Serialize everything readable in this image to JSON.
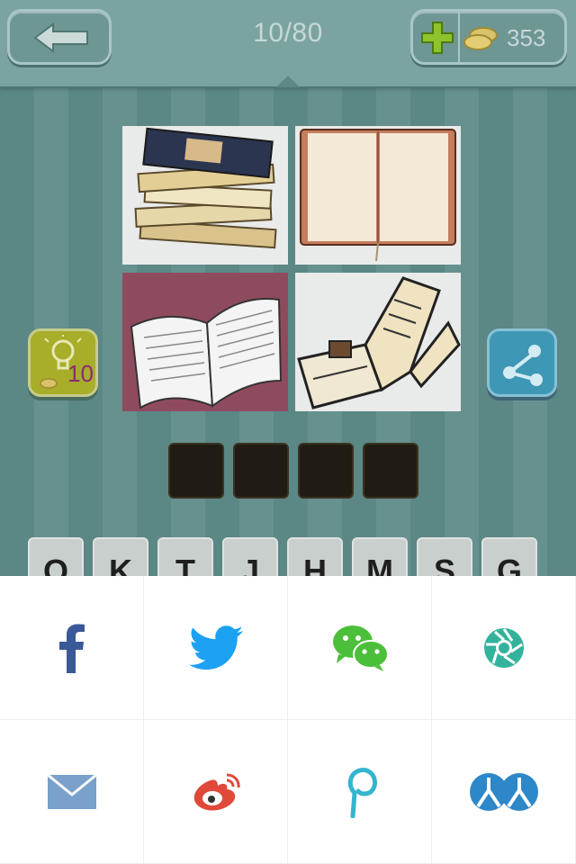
{
  "header": {
    "level": "10/80",
    "coins": "353"
  },
  "hint": {
    "cost": "10"
  },
  "answer_slots": [
    "",
    "",
    "",
    ""
  ],
  "letter_keys": [
    "O",
    "K",
    "T",
    "J",
    "H",
    "M",
    "S",
    "G"
  ],
  "pictures": [
    "stacked-books-image",
    "blank-notebook-image",
    "open-book-image",
    "open-book-drawing-image"
  ],
  "share_targets": [
    "facebook",
    "twitter",
    "wechat",
    "wechat-moments",
    "email",
    "weibo",
    "pinterest",
    "renren"
  ],
  "colors": {
    "background": "#5f8a88",
    "slot": "#211c13",
    "facebook": "#3b5998",
    "twitter": "#1da1f2",
    "wechat": "#4cbf3a",
    "moments": "#33b39b",
    "email": "#7aa0cc",
    "weibo": "#e0493a",
    "pinterest": "#34b5cf",
    "renren": "#2d87c9"
  }
}
